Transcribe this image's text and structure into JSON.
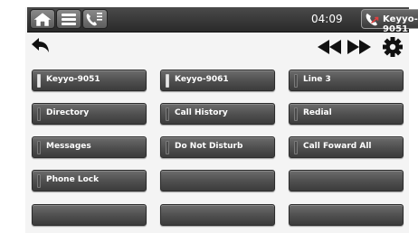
{
  "status_bar": {
    "time": "04:09",
    "active_line_label": "Keyyo-9051"
  },
  "nav": {
    "back_icon": "back-arrow-icon",
    "prev_icon": "double-left-arrow-icon",
    "next_icon": "double-right-arrow-icon",
    "settings_icon": "gear-icon"
  },
  "colors": {
    "topbar": "#2f2f2f",
    "key_face": "#555555",
    "key_text": "#ffffff",
    "indicator_lit": "#e8e8e8"
  },
  "keys": [
    {
      "label": "Keyyo-9051",
      "indicator": "lit"
    },
    {
      "label": "Keyyo-9061",
      "indicator": "lit"
    },
    {
      "label": "Line 3",
      "indicator": "off"
    },
    {
      "label": "Directory",
      "indicator": "off"
    },
    {
      "label": "Call History",
      "indicator": "off"
    },
    {
      "label": "Redial",
      "indicator": "off"
    },
    {
      "label": "Messages",
      "indicator": "off"
    },
    {
      "label": "Do Not Disturb",
      "indicator": "off"
    },
    {
      "label": "Call Foward All",
      "indicator": "off"
    },
    {
      "label": "Phone Lock",
      "indicator": "off"
    },
    {
      "label": "",
      "indicator": "none"
    },
    {
      "label": "",
      "indicator": "none"
    },
    {
      "label": "",
      "indicator": "none"
    },
    {
      "label": "",
      "indicator": "none"
    },
    {
      "label": "",
      "indicator": "none"
    }
  ]
}
